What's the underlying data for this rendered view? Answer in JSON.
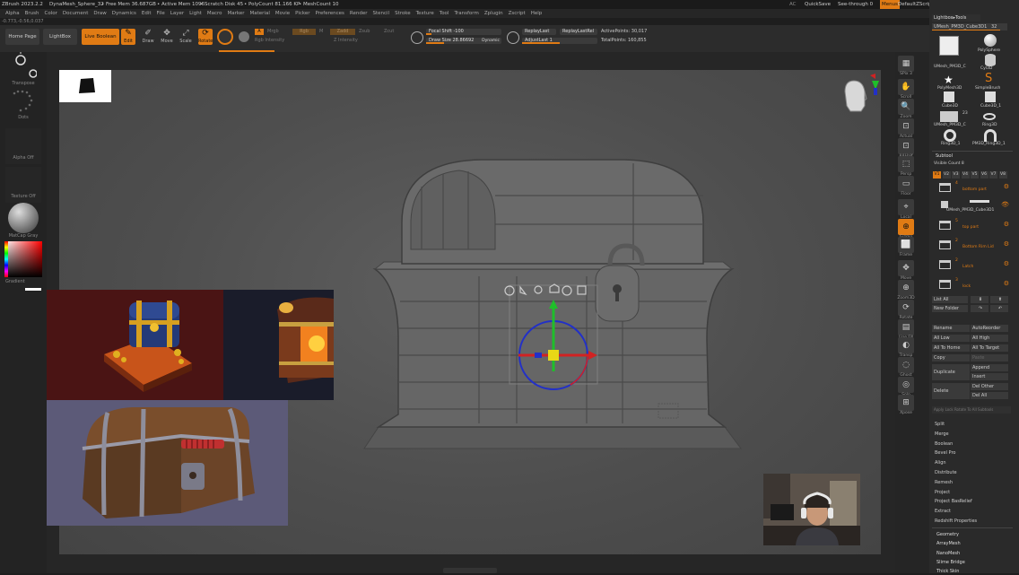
{
  "titlebar": {
    "app": "ZBrush 2023.2.2",
    "document": "DynaMesh_Sphere_32",
    "free_mem": "• Free Mem 36.687GB",
    "active_mem": "• Active Mem 1096",
    "scratch_disk": "• Scratch Disk 45",
    "polycount": "• PolyCount 81.166 KP",
    "meshcount": "• MeshCount 10",
    "ac": "AC",
    "quicksave": "QuickSave",
    "see_through": "See-through 0",
    "menus": "Menus",
    "default_zscript": "DefaultZScript"
  },
  "menubar": [
    "Alpha",
    "Brush",
    "Color",
    "Document",
    "Draw",
    "Dynamics",
    "Edit",
    "File",
    "Layer",
    "Light",
    "Macro",
    "Marker",
    "Material",
    "Movie",
    "Picker",
    "Preferences",
    "Render",
    "Stencil",
    "Stroke",
    "Texture",
    "Tool",
    "Transform",
    "Zplugin",
    "Zscript",
    "Help"
  ],
  "coords": "-0.773,-0.56,0.037",
  "toolbar": {
    "home_page": "Home Page",
    "lightbox": "LightBox",
    "live_boolean": "Live Boolean",
    "edit": "Edit",
    "draw": "Draw",
    "move": "Move",
    "scale": "Scale",
    "rotate": "Rotate",
    "mrgb": "Mrgb",
    "rgb": "Rgb",
    "m": "M",
    "rgb_intensity": "Rgb Intensity",
    "zadd": "Zadd",
    "zsub": "Zsub",
    "zcut": "Zcut",
    "z_intensity": "Z Intensity",
    "focal_shift": "Focal Shift -100",
    "draw_size": "Draw Size 28.86692",
    "dynamic": "Dynamic",
    "replay_last": "ReplayLast",
    "replay_last_rel": "ReplayLastRel",
    "adjust_last": "AdjustLast 1",
    "active_points": "ActivePoints: 30,017",
    "total_points": "TotalPoints: 160,855"
  },
  "left_shelf": {
    "transpose": "Transpose",
    "dots": "Dots",
    "alpha_off": "Alpha Off",
    "texture_off": "Texture Off",
    "matcap_gray": "MatCap Gray",
    "gradient": "Gradient"
  },
  "right_shelf": [
    {
      "label": "SPix 3",
      "icon": "spix-icon"
    },
    {
      "label": "Scroll",
      "icon": "scroll-icon"
    },
    {
      "label": "Zoom",
      "icon": "zoom-icon"
    },
    {
      "label": "Actual",
      "icon": "actual-icon"
    },
    {
      "label": "AAHalf",
      "icon": "aahalf-icon"
    },
    {
      "label": "Persp",
      "icon": "persp-icon"
    },
    {
      "label": "Floor",
      "icon": "floor-icon"
    },
    {
      "label": "Local",
      "icon": "local-icon"
    },
    {
      "label": "Gizmo",
      "icon": "gizmo-icon"
    },
    {
      "label": "Frame",
      "icon": "frame-icon"
    },
    {
      "label": "Move",
      "icon": "move-icon"
    },
    {
      "label": "Zoom3D",
      "icon": "zoom3d-icon"
    },
    {
      "label": "Rotate",
      "icon": "rotate-icon"
    },
    {
      "label": "Line Fill",
      "icon": "linefill-icon"
    },
    {
      "label": "Transp",
      "icon": "transp-icon"
    },
    {
      "label": "Ghost",
      "icon": "ghost-icon"
    },
    {
      "label": "Solo",
      "icon": "solo-icon"
    },
    {
      "label": "Xpose",
      "icon": "xpose-icon"
    }
  ],
  "tool_panel": {
    "lightbox_tools": "Lightbox▸Tools",
    "current_tool": "UMesh_PM3D_Cube3D1",
    "current_count": "32",
    "thumbs": [
      {
        "label": "UMesh_PM3D_C"
      },
      {
        "label": "PolySphere"
      },
      {
        "label": "Cyl3D"
      },
      {
        "label": "PolyMesh3D"
      },
      {
        "label": "SimpleBrush"
      },
      {
        "label": "Cube3D"
      },
      {
        "label": "Cube3D_1"
      },
      {
        "label": "UMesh_PM3D_C"
      },
      {
        "label": "Ring3D"
      },
      {
        "label": "Ring3D_1"
      },
      {
        "label": "PM3D_Ring3D_1"
      }
    ],
    "thumb_badge": "23"
  },
  "subtool": {
    "title": "Subtool",
    "visible_count": "Visible Count 8",
    "tabs": [
      "V1",
      "V2",
      "V3",
      "V4",
      "V5",
      "V6",
      "V7",
      "V8"
    ],
    "folders": [
      {
        "num": "4",
        "name": "bottom part"
      },
      {
        "num": "",
        "name": "UMesh_PM3D_Cube3D1"
      },
      {
        "num": "5",
        "name": "top part"
      },
      {
        "num": "2",
        "name": "Bottom Rim Lid"
      },
      {
        "num": "2",
        "name": "Latch"
      },
      {
        "num": "3",
        "name": "lock"
      }
    ],
    "list_all": "List All",
    "new_folder": "New Folder",
    "rename": "Rename",
    "autoreorder": "AutoReorder",
    "all_low": "All Low",
    "all_high": "All High",
    "all_to_home": "All To Home",
    "all_to_target": "All To Target",
    "copy": "Copy",
    "paste": "Paste",
    "duplicate": "Duplicate",
    "append": "Append",
    "insert": "Insert",
    "delete": "Delete",
    "del_other": "Del Other",
    "del_all": "Del All",
    "apply_lock": "Apply Lock Rotate To All Subtools",
    "menu": [
      "Split",
      "Merge",
      "Boolean",
      "Bevel Pro",
      "Align",
      "Distribute",
      "Remesh",
      "Project",
      "Project BasRelief",
      "Extract",
      "Redshift Properties"
    ],
    "bottom": [
      "Geometry",
      "ArrayMesh",
      "NanoMesh",
      "Slime Bridge",
      "Thick Skin"
    ]
  },
  "colors": {
    "accent": "#e07b14",
    "gizmo_green": "#1fbf2a",
    "gizmo_red": "#d12222",
    "gizmo_blue": "#2230c8",
    "gizmo_yellow": "#e8d816"
  }
}
